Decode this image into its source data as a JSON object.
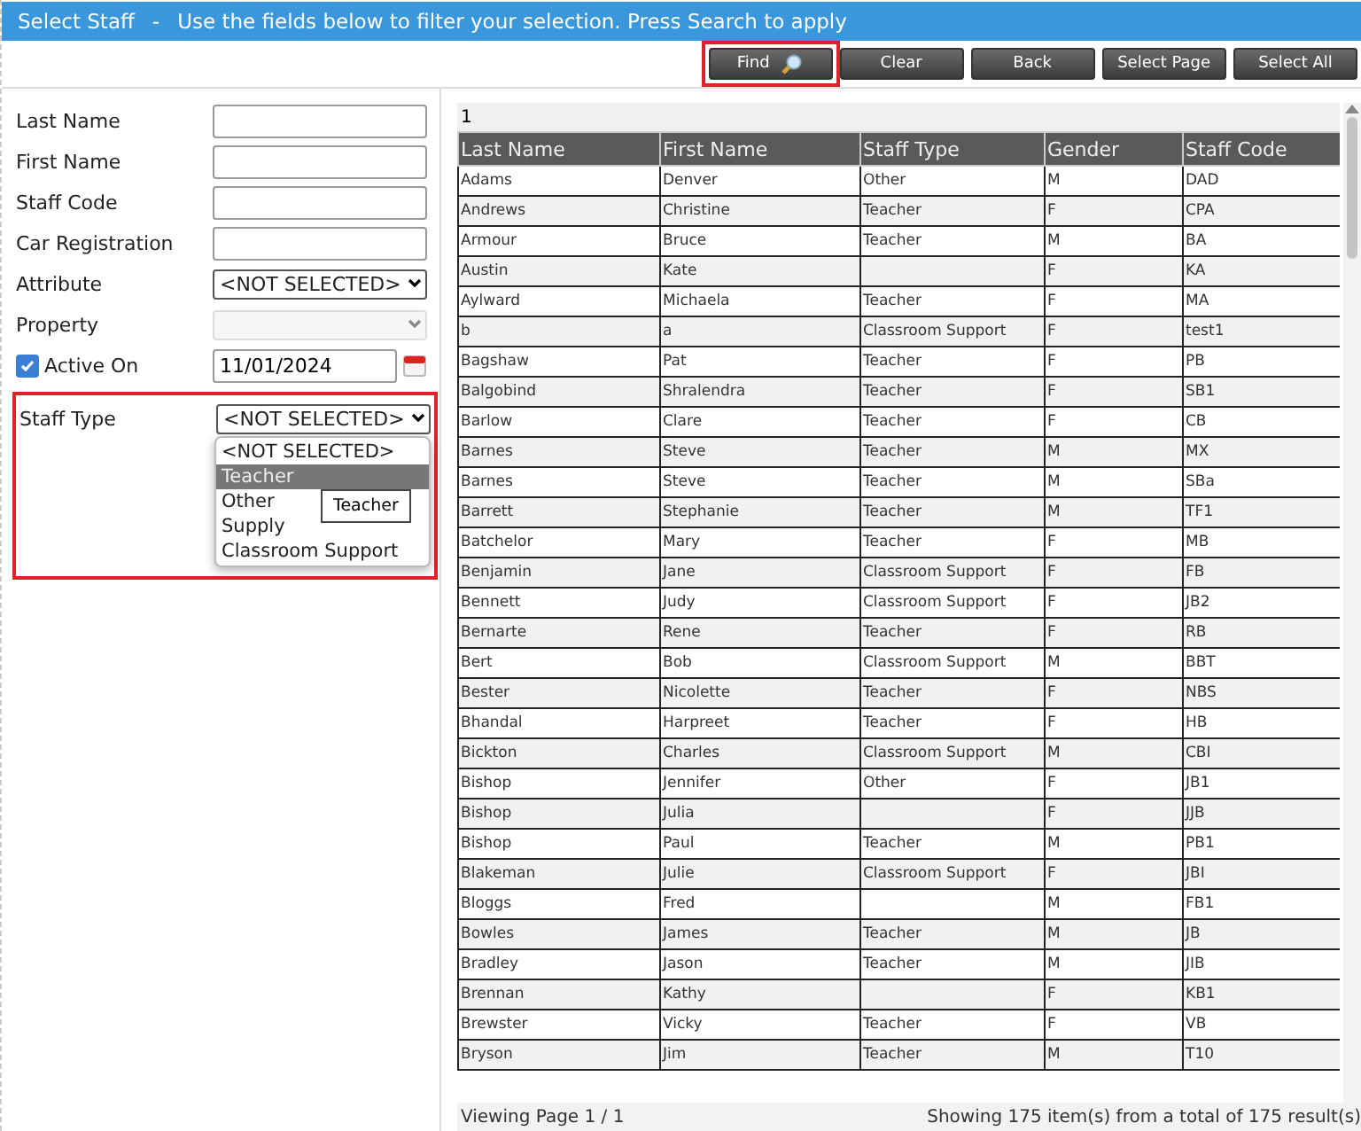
{
  "title_bar": {
    "title": "Select Staff",
    "separator": "-",
    "hint": "Use the fields below to filter your selection. Press Search to apply"
  },
  "toolbar": {
    "buttons": [
      {
        "label": "Find",
        "kind": "find",
        "highlighted": true
      },
      {
        "label": "Clear",
        "kind": "plain",
        "highlighted": false
      },
      {
        "label": "Back",
        "kind": "plain",
        "highlighted": false
      },
      {
        "label": "Select Page",
        "kind": "plain",
        "highlighted": false
      },
      {
        "label": "Select All",
        "kind": "plain",
        "highlighted": false
      }
    ]
  },
  "filters": [
    {
      "label": "Last Name",
      "kind": "text"
    },
    {
      "label": "First Name",
      "kind": "text"
    },
    {
      "label": "Staff Code",
      "kind": "text"
    },
    {
      "label": "Car Registration",
      "kind": "text"
    },
    {
      "label": "Attribute",
      "kind": "select",
      "value": "<NOT SELECTED>",
      "disabled": false
    },
    {
      "label": "Property",
      "kind": "select",
      "disabled": true
    },
    {
      "label": "Active On",
      "kind": "date",
      "checked": true,
      "value": "11/01/2024"
    }
  ],
  "staff_type": {
    "label": "Staff Type",
    "value": "<NOT SELECTED>",
    "highlighted": true,
    "expanded": true,
    "options": [
      {
        "label": "<NOT SELECTED>",
        "hovered": false
      },
      {
        "label": "Teacher",
        "hovered": true
      },
      {
        "label": "Other",
        "hovered": false
      },
      {
        "label": "Supply",
        "hovered": false
      },
      {
        "label": "Classroom Support",
        "hovered": false
      }
    ],
    "tooltip": "Teacher"
  },
  "grid": {
    "page_links": [
      "1"
    ],
    "columns": [
      "Last Name",
      "First Name",
      "Staff Type",
      "Gender",
      "Staff Code"
    ],
    "rows": [
      [
        "Adams",
        "Denver",
        "Other",
        "M",
        "DAD"
      ],
      [
        "Andrews",
        "Christine",
        "Teacher",
        "F",
        "CPA"
      ],
      [
        "Armour",
        "Bruce",
        "Teacher",
        "M",
        "BA"
      ],
      [
        "Austin",
        "Kate",
        "",
        "F",
        "KA"
      ],
      [
        "Aylward",
        "Michaela",
        "Teacher",
        "F",
        "MA"
      ],
      [
        "b",
        "a",
        "Classroom Support",
        "F",
        "test1"
      ],
      [
        "Bagshaw",
        "Pat",
        "Teacher",
        "F",
        "PB"
      ],
      [
        "Balgobind",
        "Shralendra",
        "Teacher",
        "F",
        "SB1"
      ],
      [
        "Barlow",
        "Clare",
        "Teacher",
        "F",
        "CB"
      ],
      [
        "Barnes",
        "Steve",
        "Teacher",
        "M",
        "MX"
      ],
      [
        "Barnes",
        "Steve",
        "Teacher",
        "M",
        "SBa"
      ],
      [
        "Barrett",
        "Stephanie",
        "Teacher",
        "M",
        "TF1"
      ],
      [
        "Batchelor",
        "Mary",
        "Teacher",
        "F",
        "MB"
      ],
      [
        "Benjamin",
        "Jane",
        "Classroom Support",
        "F",
        "FB"
      ],
      [
        "Bennett",
        "Judy",
        "Classroom Support",
        "F",
        "JB2"
      ],
      [
        "Bernarte",
        "Rene",
        "Teacher",
        "F",
        "RB"
      ],
      [
        "Bert",
        "Bob",
        "Classroom Support",
        "M",
        "BBT"
      ],
      [
        "Bester",
        "Nicolette",
        "Teacher",
        "F",
        "NBS"
      ],
      [
        "Bhandal",
        "Harpreet",
        "Teacher",
        "F",
        "HB"
      ],
      [
        "Bickton",
        "Charles",
        "Classroom Support",
        "M",
        "CBI"
      ],
      [
        "Bishop",
        "Jennifer",
        "Other",
        "F",
        "JB1"
      ],
      [
        "Bishop",
        "Julia",
        "",
        "F",
        "JJB"
      ],
      [
        "Bishop",
        "Paul",
        "Teacher",
        "M",
        "PB1"
      ],
      [
        "Blakeman",
        "Julie",
        "Classroom Support",
        "F",
        "JBI"
      ],
      [
        "Bloggs",
        "Fred",
        "",
        "M",
        "FB1"
      ],
      [
        "Bowles",
        "James",
        "Teacher",
        "M",
        "JB"
      ],
      [
        "Bradley",
        "Jason",
        "Teacher",
        "M",
        "JIB"
      ],
      [
        "Brennan",
        "Kathy",
        "",
        "F",
        "KB1"
      ],
      [
        "Brewster",
        "Vicky",
        "Teacher",
        "F",
        "VB"
      ],
      [
        "Bryson",
        "Jim",
        "Teacher",
        "M",
        "T10"
      ]
    ],
    "footer_left": "Viewing Page 1 / 1",
    "footer_right": "Showing 175 item(s) from a total of 175 result(s)"
  }
}
